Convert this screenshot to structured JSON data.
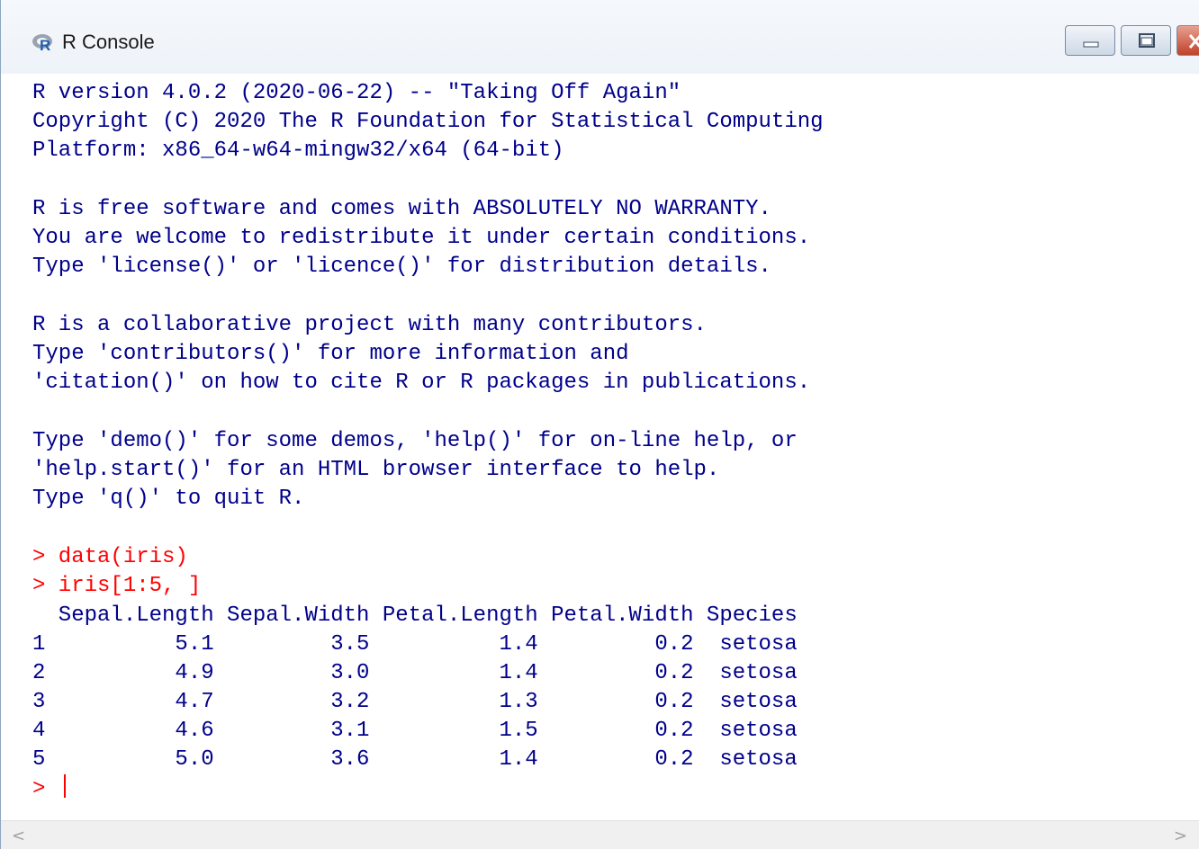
{
  "window": {
    "title": "R Console",
    "icon": "r-logo-icon",
    "controls": [
      "minimize-icon",
      "maximize-icon",
      "close-icon"
    ]
  },
  "console": {
    "banner": [
      "R version 4.0.2 (2020-06-22) -- \"Taking Off Again\"",
      "Copyright (C) 2020 The R Foundation for Statistical Computing",
      "Platform: x86_64-w64-mingw32/x64 (64-bit)",
      "",
      "R is free software and comes with ABSOLUTELY NO WARRANTY.",
      "You are welcome to redistribute it under certain conditions.",
      "Type 'license()' or 'licence()' for distribution details.",
      "",
      "R is a collaborative project with many contributors.",
      "Type 'contributors()' for more information and",
      "'citation()' on how to cite R or R packages in publications.",
      "",
      "Type 'demo()' for some demos, 'help()' for on-line help, or",
      "'help.start()' for an HTML browser interface to help.",
      "Type 'q()' to quit R."
    ],
    "commands": [
      "> data(iris)",
      "> iris[1:5, ]"
    ],
    "output": [
      "  Sepal.Length Sepal.Width Petal.Length Petal.Width Species",
      "1          5.1         3.5          1.4         0.2  setosa",
      "2          4.9         3.0          1.4         0.2  setosa",
      "3          4.7         3.2          1.3         0.2  setosa",
      "4          4.6         3.1          1.5         0.2  setosa",
      "5          5.0         3.6          1.4         0.2  setosa"
    ],
    "prompt": "> ",
    "colors": {
      "output": "#00008b",
      "input": "#ff0000"
    }
  },
  "scrollbar": {
    "left_arrow": "<",
    "right_arrow": ">"
  }
}
